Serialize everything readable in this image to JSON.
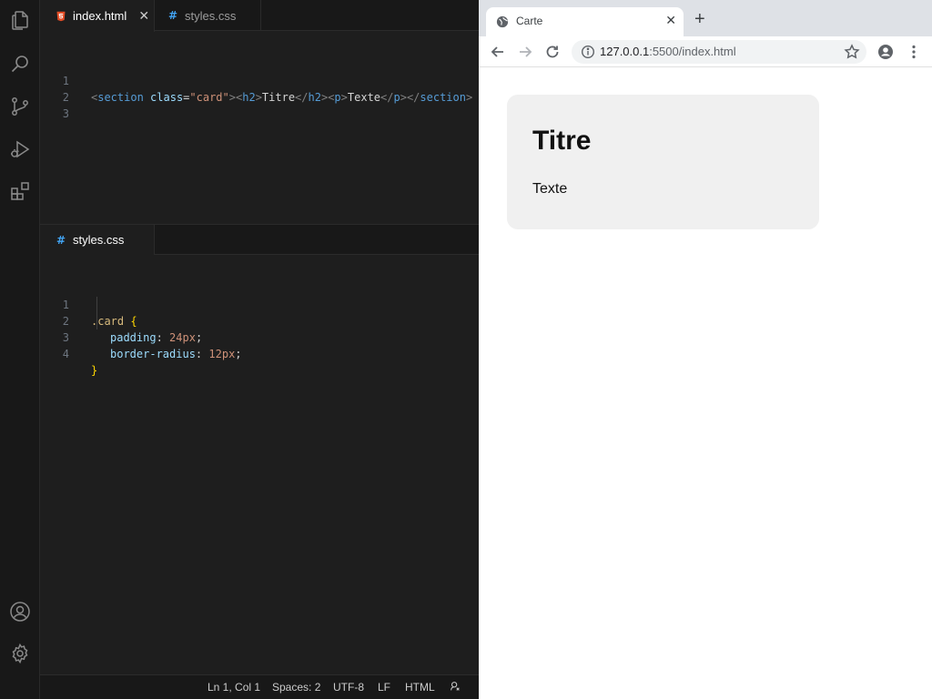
{
  "editor": {
    "top_tabs": [
      {
        "label": "index.html",
        "icon": "html5-icon",
        "active": true
      },
      {
        "label": "styles.css",
        "icon": "css-hash-icon",
        "active": false
      }
    ],
    "html_code": {
      "line_numbers": [
        "1",
        "2",
        "3"
      ],
      "line1": {
        "lt1": "<",
        "section": "section",
        "class_attr": "class",
        "eq": "=",
        "class_val": "\"card\"",
        "gt1": ">",
        "lt2": "<",
        "h2_open": "h2",
        "gt2": ">",
        "title": "Titre",
        "lt3": "</",
        "h2_close": "h2",
        "gt3": ">",
        "lt4": "<",
        "p_open": "p",
        "gt4": ">",
        "text": "Texte",
        "lt5": "</",
        "p_close": "p",
        "gt5": ">",
        "lt6": "</",
        "section_close": "section",
        "gt6": ">"
      }
    },
    "bottom_tab": {
      "label": "styles.css",
      "icon": "css-hash-icon"
    },
    "css_code": {
      "line_numbers": [
        "1",
        "2",
        "3",
        "4"
      ],
      "selector": ".card",
      "open_brace": "{",
      "prop1": "padding",
      "val1": "24px",
      "prop2": "border-radius",
      "val2": "12px",
      "colon": ":",
      "semi": ";",
      "close_brace": "}"
    },
    "status_bar": {
      "cursor": "Ln 1, Col 1",
      "spaces": "Spaces: 2",
      "encoding": "UTF-8",
      "eol": "LF",
      "language": "HTML"
    }
  },
  "activity_bar": {
    "top": [
      "files-icon",
      "search-icon",
      "source-control-icon",
      "run-debug-icon",
      "extensions-icon"
    ],
    "bottom": [
      "account-icon",
      "gear-icon"
    ]
  },
  "browser": {
    "tab_title": "Carte",
    "new_tab": "+",
    "url_host": "127.0.0.1",
    "url_rest": ":5500/index.html",
    "page": {
      "heading": "Titre",
      "paragraph": "Texte"
    }
  },
  "colors": {
    "editor_bg": "#1e1e1e",
    "activity_bg": "#181818",
    "html_icon": "#e44d26",
    "css_icon": "#42a5f5",
    "card_bg": "#f0f0f0",
    "tabstrip_bg": "#dee1e6"
  }
}
